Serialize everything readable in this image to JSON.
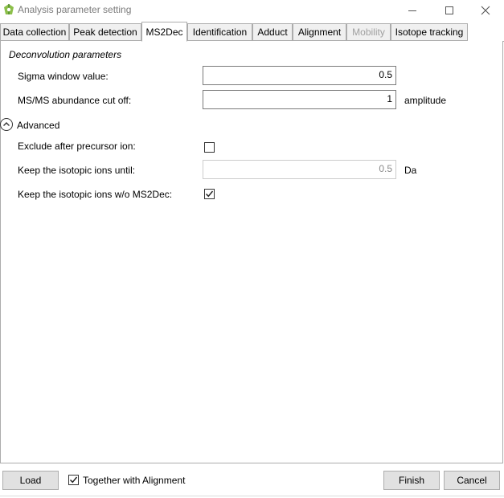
{
  "window": {
    "title": "Analysis parameter setting"
  },
  "tabs": [
    {
      "label": "Data collection"
    },
    {
      "label": "Peak detection"
    },
    {
      "label": "MS2Dec"
    },
    {
      "label": "Identification"
    },
    {
      "label": "Adduct"
    },
    {
      "label": "Alignment"
    },
    {
      "label": "Mobility"
    },
    {
      "label": "Isotope tracking"
    }
  ],
  "active_tab": "MS2Dec",
  "disabled_tab": "Mobility",
  "section": {
    "title": "Deconvolution parameters"
  },
  "fields": {
    "sigma": {
      "label": "Sigma window value:",
      "value": "0.5"
    },
    "cutoff": {
      "label": "MS/MS abundance cut off:",
      "value": "1",
      "unit": "amplitude"
    }
  },
  "advanced": {
    "label": "Advanced",
    "exclude": {
      "label": "Exclude after precursor ion:",
      "checked": false
    },
    "keep_until": {
      "label": "Keep the isotopic ions until:",
      "value": "0.5",
      "unit": "Da"
    },
    "keep_wo": {
      "label": "Keep the isotopic ions w/o MS2Dec:",
      "checked": true
    }
  },
  "footer": {
    "load_label": "Load",
    "together_label": "Together with Alignment",
    "together_checked": true,
    "finish_label": "Finish",
    "cancel_label": "Cancel"
  },
  "icons": {
    "app": "msdial-logo-icon",
    "minimize": "minimize-icon",
    "maximize": "maximize-icon",
    "close": "close-icon",
    "expander": "chevron-up-icon",
    "check": "checkmark-icon"
  }
}
